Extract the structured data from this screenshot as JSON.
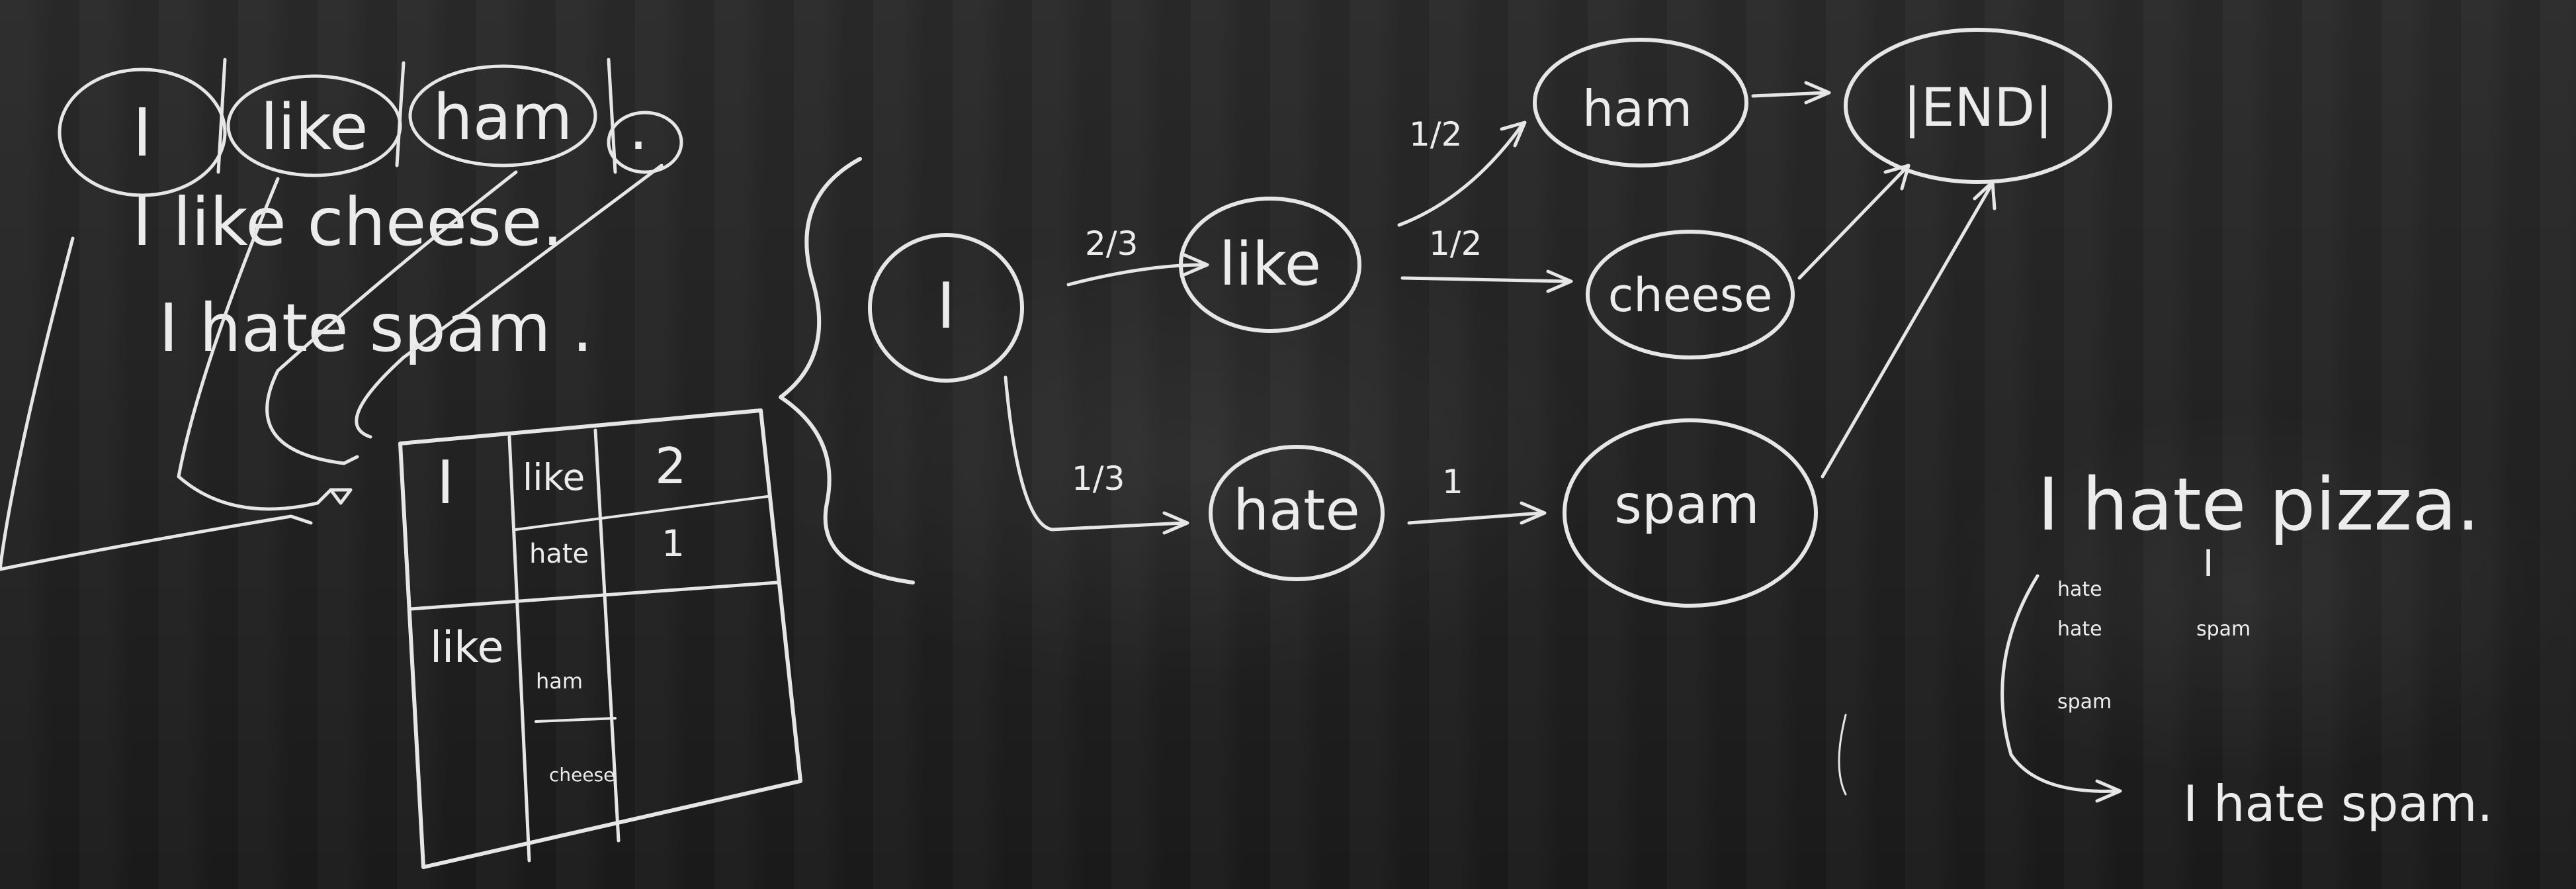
{
  "sentences": {
    "line1": [
      "I",
      "like",
      "ham",
      "."
    ],
    "line2": "I like cheese.",
    "line3": "I hate spam ."
  },
  "table": {
    "rows": [
      {
        "word": "I",
        "next": [
          {
            "word": "like",
            "count": "2"
          },
          {
            "word": "hate",
            "count": "1"
          }
        ]
      },
      {
        "word": "like",
        "next": [
          {
            "word": "ham",
            "count": ""
          },
          {
            "word": "cheese",
            "count": ""
          }
        ]
      }
    ]
  },
  "graph": {
    "nodes": {
      "I": "I",
      "like": "like",
      "hate": "hate",
      "ham": "ham",
      "cheese": "cheese",
      "spam": "spam",
      "end": "|END|"
    },
    "edges": {
      "I_like": "2/3",
      "I_hate": "1/3",
      "like_ham": "1/2",
      "like_cheese": "1/2",
      "hate_spam": "1"
    }
  },
  "example": {
    "input": "I hate pizza.",
    "col1": [
      "hate",
      "hate",
      "spam"
    ],
    "col2": [
      "I",
      "spam"
    ],
    "output": "I hate spam."
  }
}
